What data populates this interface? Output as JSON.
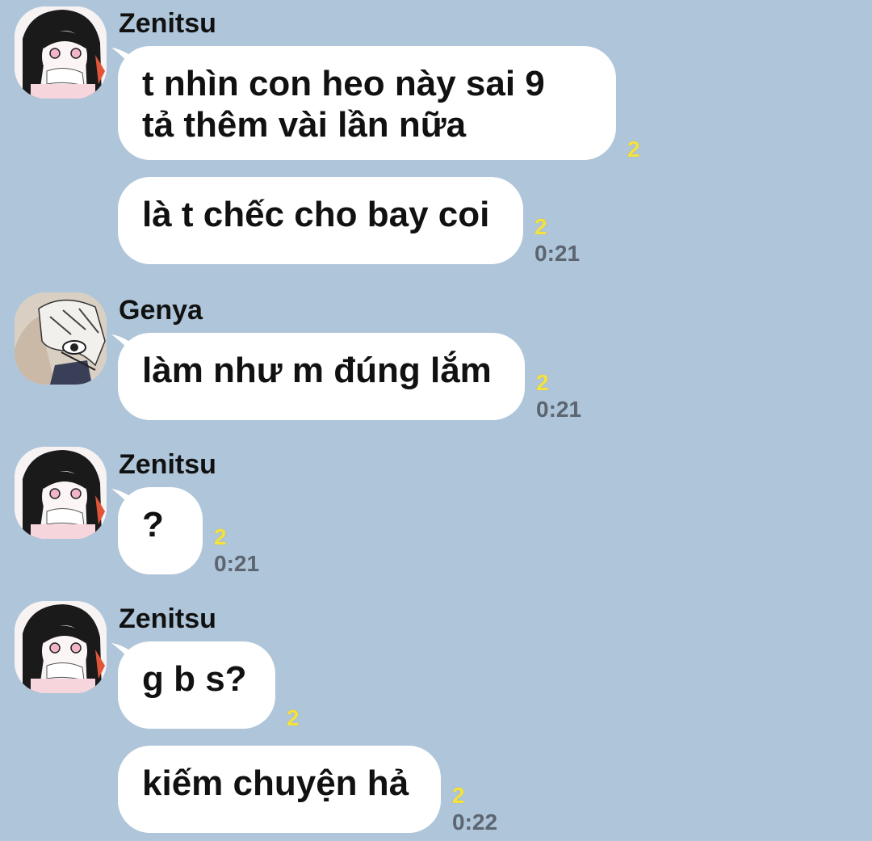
{
  "colors": {
    "background": "#afc5da",
    "bubble": "#ffffff",
    "read_count": "#f5e23c",
    "time": "#5c6570"
  },
  "messages": [
    {
      "sender": "Zenitsu",
      "avatar_icon": "girl-avatar-icon",
      "bubbles": [
        {
          "lines": [
            "t nhìn con heo này sai 9",
            "tả thêm vài lần nữa"
          ],
          "read": "2",
          "time": ""
        },
        {
          "lines": [
            "là t chếc cho bay coi"
          ],
          "read": "2",
          "time": "0:21"
        }
      ]
    },
    {
      "sender": "Genya",
      "avatar_icon": "boy-avatar-icon",
      "bubbles": [
        {
          "lines": [
            "làm như m đúng lắm"
          ],
          "read": "2",
          "time": "0:21"
        }
      ]
    },
    {
      "sender": "Zenitsu",
      "avatar_icon": "girl-avatar-icon",
      "bubbles": [
        {
          "lines": [
            "?"
          ],
          "read": "2",
          "time": "0:21"
        }
      ]
    },
    {
      "sender": "Zenitsu",
      "avatar_icon": "girl-avatar-icon",
      "bubbles": [
        {
          "lines": [
            "g b s?"
          ],
          "read": "2",
          "time": ""
        },
        {
          "lines": [
            "kiếm chuyện hả"
          ],
          "read": "2",
          "time": "0:22"
        }
      ]
    }
  ]
}
